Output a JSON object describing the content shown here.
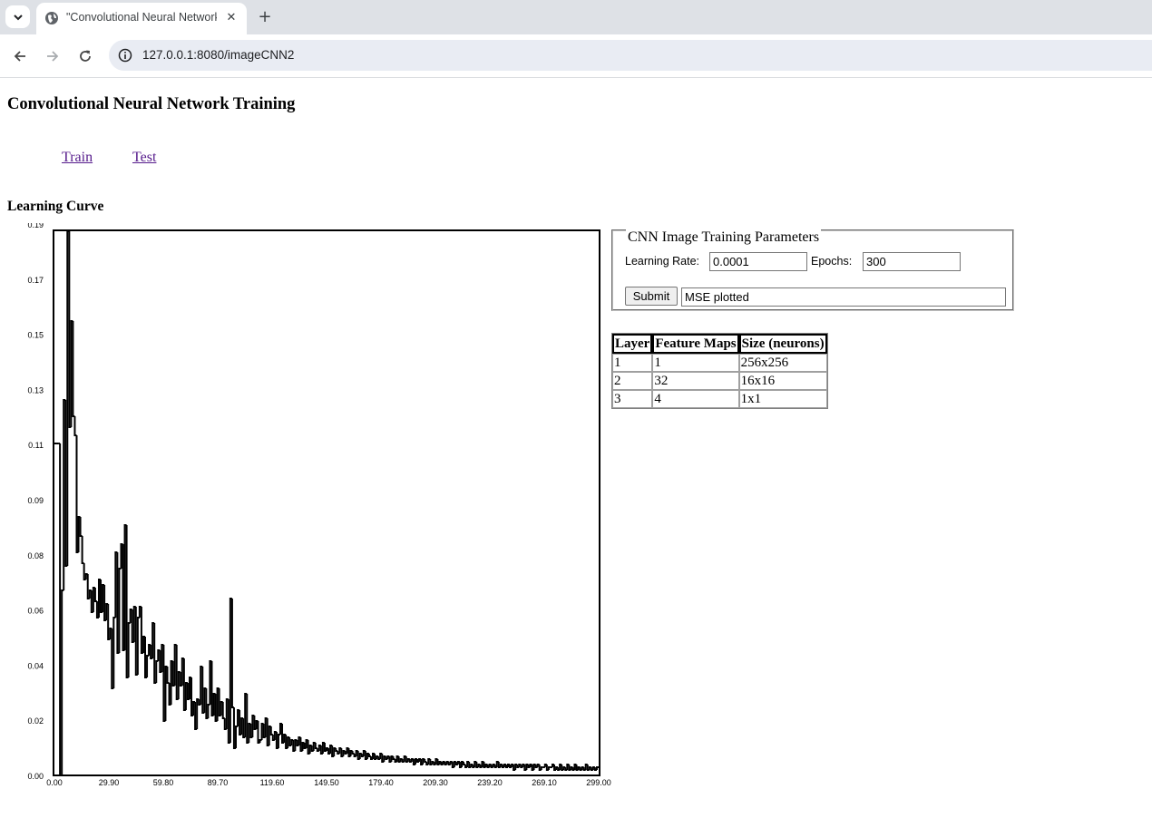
{
  "browser": {
    "tab_title": "\"Convolutional Neural Network",
    "url": "127.0.0.1:8080/imageCNN2"
  },
  "page": {
    "title": "Convolutional Neural Network Training",
    "nav_links": [
      "Train",
      "Test"
    ],
    "section_title": "Learning Curve"
  },
  "form": {
    "legend": "CNN Image Training Parameters",
    "learning_rate_label": "Learning Rate:",
    "learning_rate_value": "0.0001",
    "epochs_label": "Epochs:",
    "epochs_value": "300",
    "submit_label": "Submit",
    "status_value": "MSE plotted"
  },
  "layers_table": {
    "headers": [
      "Layer",
      "Feature Maps",
      "Size (neurons)"
    ],
    "rows": [
      [
        "1",
        "1",
        "256x256"
      ],
      [
        "2",
        "32",
        "16x16"
      ],
      [
        "3",
        "4",
        "1x1"
      ]
    ]
  },
  "chart_data": {
    "type": "line",
    "title": "",
    "xlabel": "",
    "ylabel": "",
    "xlim": [
      0,
      299
    ],
    "ylim": [
      0,
      0.2
    ],
    "x_tick_labels": [
      "0.00",
      "29.90",
      "59.80",
      "89.70",
      "119.60",
      "149.50",
      "179.40",
      "209.30",
      "239.20",
      "269.10",
      "299.00"
    ],
    "y_tick_labels": [
      "0.00",
      "0.02",
      "0.04",
      "0.06",
      "0.08",
      "0.09",
      "0.11",
      "0.13",
      "0.15",
      "0.17",
      "0.19"
    ],
    "series": [
      {
        "values": [
          0.122,
          0.122,
          0.122,
          0.0,
          0.068,
          0.138,
          0.077,
          0.2,
          0.128,
          0.167,
          0.132,
          0.125,
          0.082,
          0.095,
          0.088,
          0.078,
          0.072,
          0.074,
          0.065,
          0.068,
          0.06,
          0.069,
          0.064,
          0.058,
          0.072,
          0.06,
          0.07,
          0.057,
          0.063,
          0.05,
          0.054,
          0.032,
          0.058,
          0.082,
          0.045,
          0.076,
          0.085,
          0.046,
          0.092,
          0.036,
          0.056,
          0.061,
          0.049,
          0.062,
          0.037,
          0.058,
          0.062,
          0.045,
          0.051,
          0.036,
          0.044,
          0.048,
          0.043,
          0.056,
          0.034,
          0.042,
          0.046,
          0.038,
          0.048,
          0.02,
          0.04,
          0.034,
          0.026,
          0.042,
          0.033,
          0.048,
          0.028,
          0.038,
          0.033,
          0.043,
          0.024,
          0.034,
          0.028,
          0.036,
          0.022,
          0.027,
          0.017,
          0.028,
          0.026,
          0.04,
          0.023,
          0.032,
          0.021,
          0.026,
          0.042,
          0.022,
          0.03,
          0.02,
          0.032,
          0.022,
          0.027,
          0.021,
          0.017,
          0.028,
          0.012,
          0.065,
          0.025,
          0.01,
          0.018,
          0.024,
          0.015,
          0.021,
          0.014,
          0.03,
          0.012,
          0.019,
          0.014,
          0.022,
          0.017,
          0.02,
          0.012,
          0.013,
          0.019,
          0.014,
          0.021,
          0.011,
          0.018,
          0.015,
          0.013,
          0.016,
          0.01,
          0.015,
          0.019,
          0.012,
          0.015,
          0.01,
          0.014,
          0.011,
          0.013,
          0.009,
          0.013,
          0.011,
          0.014,
          0.009,
          0.012,
          0.01,
          0.013,
          0.008,
          0.011,
          0.009,
          0.012,
          0.01,
          0.009,
          0.011,
          0.008,
          0.012,
          0.009,
          0.01,
          0.008,
          0.011,
          0.007,
          0.01,
          0.009,
          0.008,
          0.01,
          0.007,
          0.009,
          0.008,
          0.01,
          0.007,
          0.009,
          0.008,
          0.007,
          0.009,
          0.006,
          0.008,
          0.007,
          0.009,
          0.006,
          0.008,
          0.007,
          0.006,
          0.008,
          0.006,
          0.007,
          0.006,
          0.008,
          0.005,
          0.007,
          0.006,
          0.007,
          0.005,
          0.007,
          0.006,
          0.005,
          0.007,
          0.005,
          0.006,
          0.005,
          0.007,
          0.005,
          0.006,
          0.005,
          0.006,
          0.004,
          0.006,
          0.005,
          0.006,
          0.004,
          0.006,
          0.005,
          0.004,
          0.006,
          0.004,
          0.005,
          0.004,
          0.006,
          0.004,
          0.005,
          0.004,
          0.005,
          0.004,
          0.005,
          0.004,
          0.005,
          0.003,
          0.005,
          0.004,
          0.005,
          0.003,
          0.005,
          0.004,
          0.003,
          0.005,
          0.003,
          0.004,
          0.003,
          0.005,
          0.003,
          0.004,
          0.003,
          0.005,
          0.003,
          0.004,
          0.003,
          0.004,
          0.003,
          0.004,
          0.003,
          0.005,
          0.003,
          0.004,
          0.003,
          0.004,
          0.003,
          0.004,
          0.003,
          0.004,
          0.002,
          0.004,
          0.003,
          0.004,
          0.003,
          0.004,
          0.002,
          0.004,
          0.003,
          0.004,
          0.002,
          0.004,
          0.003,
          0.004,
          0.002,
          0.003,
          0.003,
          0.004,
          0.002,
          0.003,
          0.003,
          0.004,
          0.002,
          0.003,
          0.002,
          0.004,
          0.002,
          0.003,
          0.002,
          0.004,
          0.002,
          0.003,
          0.002,
          0.004,
          0.002,
          0.003,
          0.002,
          0.003,
          0.002,
          0.004,
          0.002,
          0.003,
          0.002,
          0.003,
          0.002,
          0.003
        ]
      }
    ],
    "grid": false,
    "line_color": "#000000"
  }
}
